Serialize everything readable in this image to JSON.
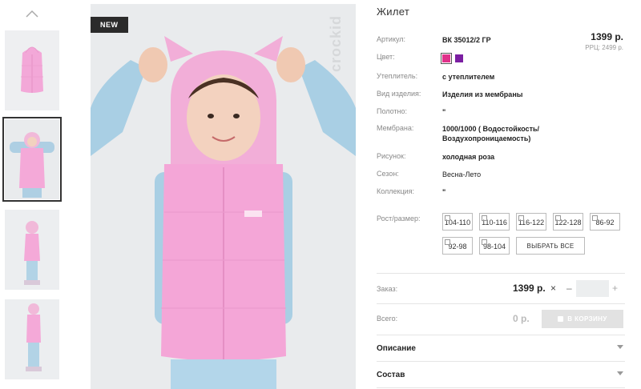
{
  "gallery": {
    "badge": "NEW",
    "brand": "crockid",
    "thumbs": [
      "Жилет — вид спереди",
      "Девочка в жилете с капюшоном",
      "Вид сбоку",
      "Вид сбоку (2)"
    ]
  },
  "product": {
    "title": "Жилет",
    "price": "1399 р.",
    "rrc": "РРЦ: 2499 р.",
    "details": [
      {
        "label": "Артикул:",
        "value": "ВК 35012/2 ГР"
      },
      {
        "label": "Цвет:",
        "value": ""
      },
      {
        "label": "Утеплитель:",
        "value": "с утеплителем"
      },
      {
        "label": "Вид изделия:",
        "value": "Изделия из мембраны"
      },
      {
        "label": "Полотно:",
        "value": "\""
      },
      {
        "label": "Мембрана:",
        "value": "1000/1000 ( Водостойкость/ Воздухопроницаемость)"
      },
      {
        "label": "Рисунок:",
        "value": "холодная роза"
      },
      {
        "label": "Сезон:",
        "value": "Весна-Лето"
      },
      {
        "label": "Коллекция:",
        "value": "\""
      }
    ],
    "colors": [
      "#e0318a",
      "#7b1fa2"
    ],
    "sizes_label": "Рост/размер:",
    "sizes": [
      "104-110",
      "110-116",
      "116-122",
      "122-128",
      "86-92",
      "92-98",
      "98-104"
    ],
    "select_all": "ВЫБРАТЬ ВСЕ"
  },
  "order": {
    "label": "Заказ:",
    "price": "1399 р.",
    "remove": "×",
    "minus": "–",
    "qty_value": "",
    "plus": "+"
  },
  "total": {
    "label": "Всего:",
    "value": "0 р.",
    "cart_button": "В КОРЗИНУ"
  },
  "accordions": [
    "Описание",
    "Состав"
  ]
}
